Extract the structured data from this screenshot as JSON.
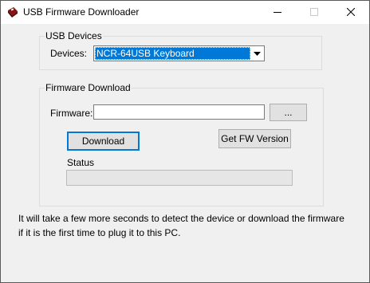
{
  "window": {
    "title": "USB Firmware Downloader"
  },
  "usb_devices": {
    "group_label": "USB Devices",
    "devices_label": "Devices:",
    "selected_device": "NCR-64USB Keyboard"
  },
  "firmware_download": {
    "group_label": "Firmware Download",
    "firmware_label": "Firmware:",
    "firmware_path": "",
    "browse_label": "...",
    "download_label": "Download",
    "get_fw_version_label": "Get FW Version",
    "status_label": "Status",
    "progress": 0
  },
  "info": {
    "line1": "It will take a few more seconds to detect the device or download the firmware",
    "line2": "if it is the first time to plug it to this PC."
  },
  "colors": {
    "selection": "#0078d7",
    "window_bg": "#f0f0f0"
  }
}
